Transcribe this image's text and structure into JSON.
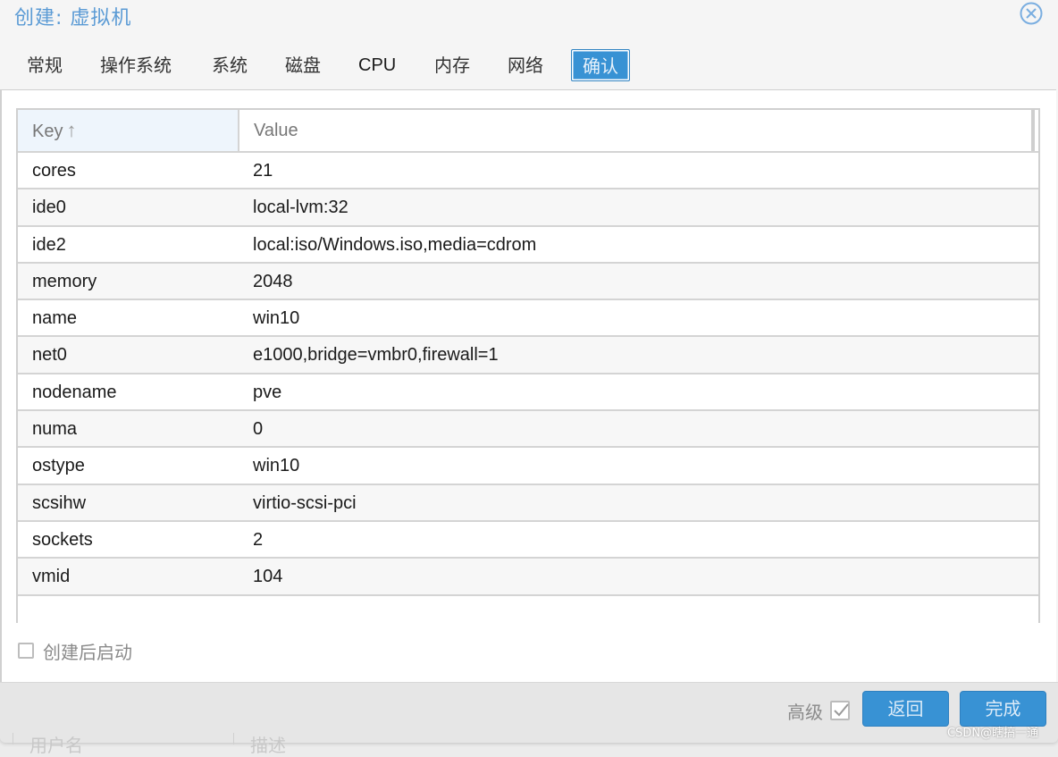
{
  "window": {
    "title": "创建: 虚拟机",
    "close_icon": "close-circle-icon"
  },
  "tabs": [
    {
      "label": "常规",
      "active": false
    },
    {
      "label": "操作系统",
      "active": false
    },
    {
      "label": "系统",
      "active": false
    },
    {
      "label": "磁盘",
      "active": false
    },
    {
      "label": "CPU",
      "active": false
    },
    {
      "label": "内存",
      "active": false
    },
    {
      "label": "网络",
      "active": false
    },
    {
      "label": "确认",
      "active": true
    }
  ],
  "grid": {
    "columns": {
      "key": "Key",
      "value": "Value"
    },
    "sort_icon": "arrow-up-icon",
    "rows": [
      {
        "key": "cores",
        "value": "21"
      },
      {
        "key": "ide0",
        "value": "local-lvm:32"
      },
      {
        "key": "ide2",
        "value": "local:iso/Windows.iso,media=cdrom"
      },
      {
        "key": "memory",
        "value": "2048"
      },
      {
        "key": "name",
        "value": "win10"
      },
      {
        "key": "net0",
        "value": "e1000,bridge=vmbr0,firewall=1"
      },
      {
        "key": "nodename",
        "value": "pve"
      },
      {
        "key": "numa",
        "value": "0"
      },
      {
        "key": "ostype",
        "value": "win10"
      },
      {
        "key": "scsihw",
        "value": "virtio-scsi-pci"
      },
      {
        "key": "sockets",
        "value": "2"
      },
      {
        "key": "vmid",
        "value": "104"
      }
    ]
  },
  "start_after_create": {
    "label": "创建后启动",
    "checked": false
  },
  "footer": {
    "advanced_label": "高级",
    "advanced_checked": true,
    "back_label": "返回",
    "finish_label": "完成"
  },
  "background_underneath": {
    "col1": "用户名",
    "col2": "描述"
  },
  "watermark": "CSDN@瞎搞一通"
}
